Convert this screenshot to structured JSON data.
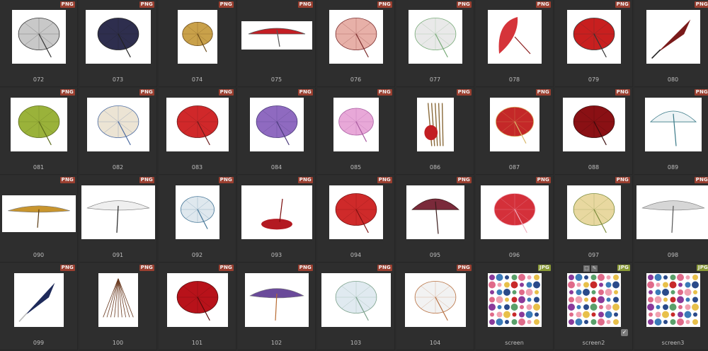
{
  "colors": {
    "background": "#2b2b2b",
    "cell": "#2e2e2e",
    "png_badge": "#9a3f30",
    "jpg_badge": "#8a9a36",
    "label": "#bdbdbd"
  },
  "items": [
    {
      "label": "072",
      "type": "PNG",
      "icon": "umbrella-gray-open-icon"
    },
    {
      "label": "073",
      "type": "PNG",
      "icon": "umbrella-navy-open-icon"
    },
    {
      "label": "074",
      "type": "PNG",
      "icon": "umbrella-gold-lotus-icon"
    },
    {
      "label": "075",
      "type": "PNG",
      "icon": "umbrella-red-side-icon"
    },
    {
      "label": "076",
      "type": "PNG",
      "icon": "umbrella-pink-open-icon"
    },
    {
      "label": "077",
      "type": "PNG",
      "icon": "umbrella-white-striped-icon"
    },
    {
      "label": "078",
      "type": "PNG",
      "icon": "umbrella-red-tilted-icon"
    },
    {
      "label": "079",
      "type": "PNG",
      "icon": "umbrella-red-small-icon"
    },
    {
      "label": "080",
      "type": "PNG",
      "icon": "umbrella-closed-dark-red-icon"
    },
    {
      "label": "081",
      "type": "PNG",
      "icon": "umbrella-green-open-icon"
    },
    {
      "label": "082",
      "type": "PNG",
      "icon": "umbrella-floral-white-icon"
    },
    {
      "label": "083",
      "type": "PNG",
      "icon": "umbrella-red-open-icon"
    },
    {
      "label": "084",
      "type": "PNG",
      "icon": "umbrella-purple-open-icon"
    },
    {
      "label": "085",
      "type": "PNG",
      "icon": "umbrella-pink-top-icon"
    },
    {
      "label": "086",
      "type": "PNG",
      "icon": "umbrella-bundle-icon"
    },
    {
      "label": "087",
      "type": "PNG",
      "icon": "umbrella-red-floral-icon"
    },
    {
      "label": "088",
      "type": "PNG",
      "icon": "umbrella-dark-red-large-icon"
    },
    {
      "label": "089",
      "type": "PNG",
      "icon": "umbrella-blue-side-icon"
    },
    {
      "label": "090",
      "type": "PNG",
      "icon": "umbrella-ochre-flat-icon"
    },
    {
      "label": "091",
      "type": "PNG",
      "icon": "umbrella-white-ink-icon"
    },
    {
      "label": "092",
      "type": "PNG",
      "icon": "umbrella-blue-smoke-icon"
    },
    {
      "label": "093",
      "type": "PNG",
      "icon": "umbrella-red-low-icon"
    },
    {
      "label": "094",
      "type": "PNG",
      "icon": "umbrella-red-ribbed-icon"
    },
    {
      "label": "095",
      "type": "PNG",
      "icon": "umbrella-maroon-side-icon"
    },
    {
      "label": "096",
      "type": "PNG",
      "icon": "umbrella-red-peony-icon"
    },
    {
      "label": "097",
      "type": "PNG",
      "icon": "umbrella-beige-floral-icon"
    },
    {
      "label": "098",
      "type": "PNG",
      "icon": "umbrella-gray-flat-icon"
    },
    {
      "label": "099",
      "type": "PNG",
      "icon": "umbrella-closed-navy-icon"
    },
    {
      "label": "100",
      "type": "PNG",
      "icon": "umbrella-frame-icon"
    },
    {
      "label": "101",
      "type": "PNG",
      "icon": "umbrella-red-tiny-icon"
    },
    {
      "label": "102",
      "type": "PNG",
      "icon": "umbrella-purple-flat-icon"
    },
    {
      "label": "103",
      "type": "PNG",
      "icon": "umbrella-striped-large-icon"
    },
    {
      "label": "104",
      "type": "PNG",
      "icon": "umbrella-white-tall-icon"
    },
    {
      "label": "screen",
      "type": "JPG",
      "icon": "collage-red-icon"
    },
    {
      "label": "screen2",
      "type": "JPG",
      "icon": "collage-blue-icon"
    },
    {
      "label": "screen3",
      "type": "JPG",
      "icon": "collage-mixed-icon"
    }
  ]
}
